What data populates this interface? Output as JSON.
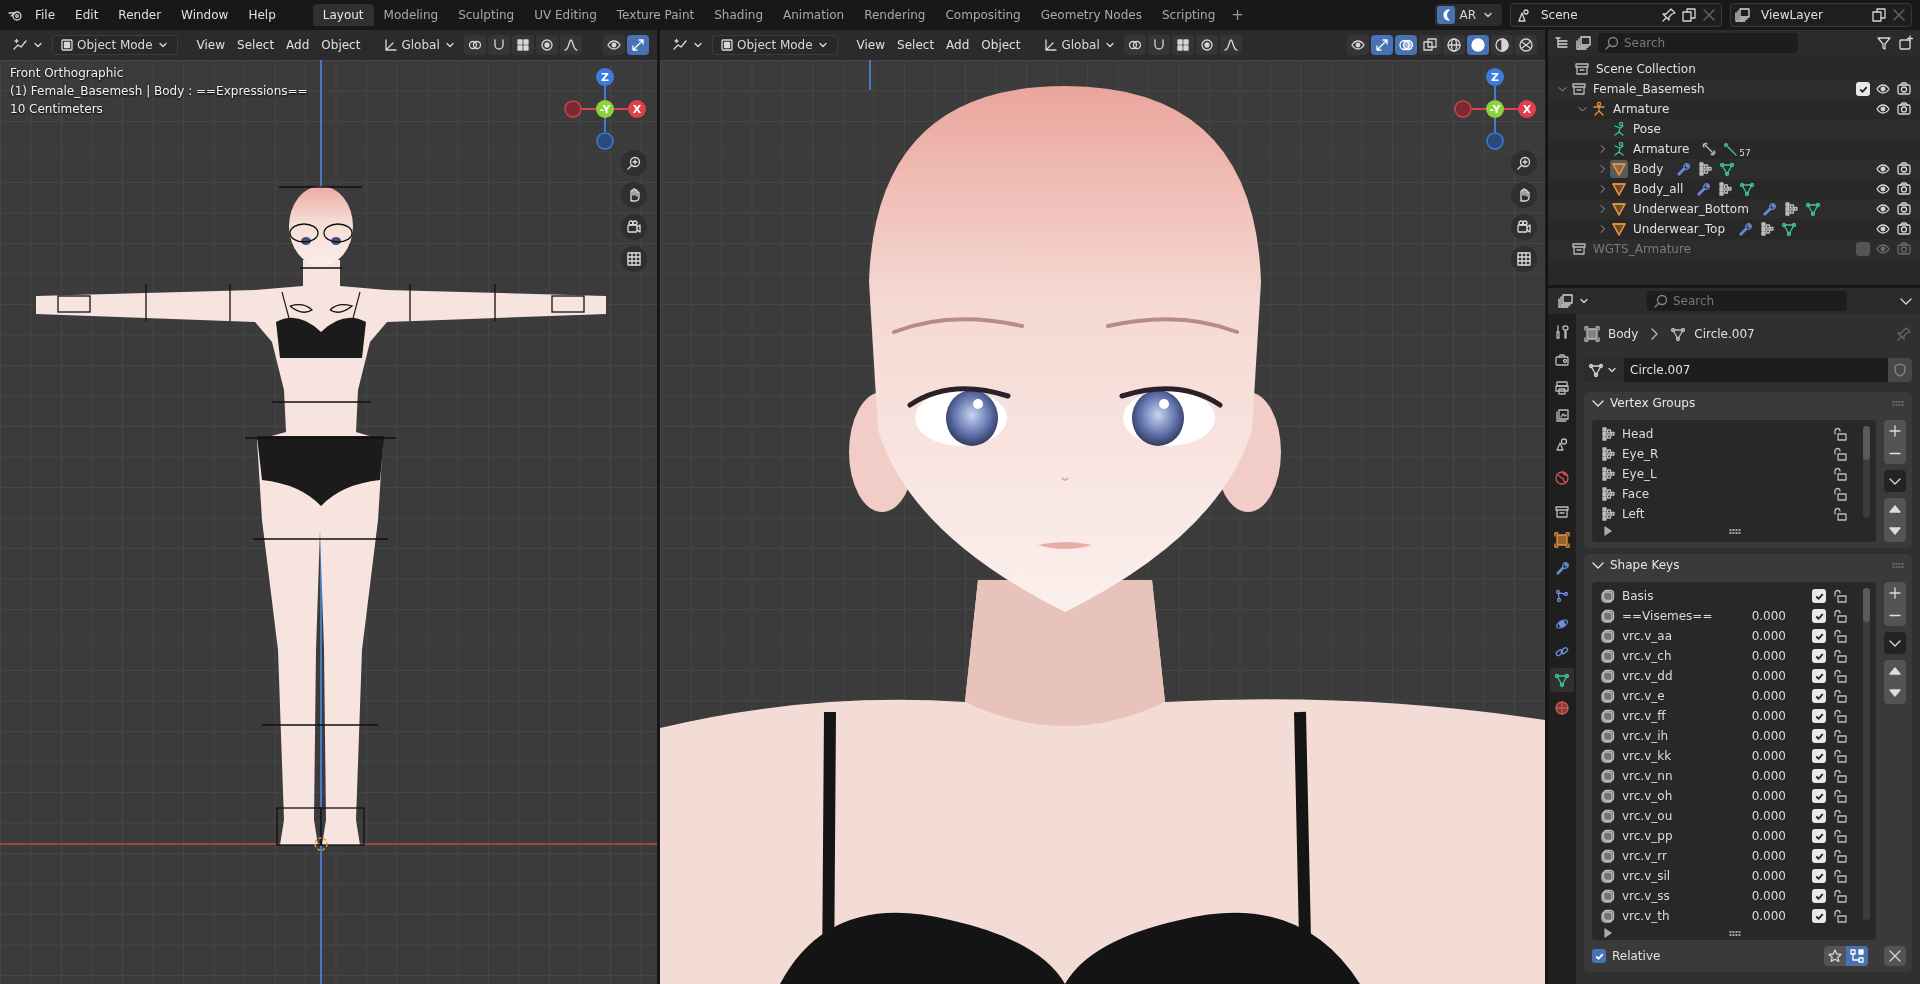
{
  "menu": [
    "File",
    "Edit",
    "Render",
    "Window",
    "Help"
  ],
  "workspaces": [
    {
      "label": "Layout",
      "selected": true
    },
    {
      "label": "Modeling",
      "selected": false
    },
    {
      "label": "Sculpting",
      "selected": false
    },
    {
      "label": "UV Editing",
      "selected": false
    },
    {
      "label": "Texture Paint",
      "selected": false
    },
    {
      "label": "Shading",
      "selected": false
    },
    {
      "label": "Animation",
      "selected": false
    },
    {
      "label": "Rendering",
      "selected": false
    },
    {
      "label": "Compositing",
      "selected": false
    },
    {
      "label": "Geometry Nodes",
      "selected": false
    },
    {
      "label": "Scripting",
      "selected": false
    }
  ],
  "add_workspace": "+",
  "engine": "AR",
  "scene": "Scene",
  "view_layer": "ViewLayer",
  "viewports": [
    {
      "kind": "front",
      "mode": "Object Mode",
      "menus": [
        "View",
        "Select",
        "Add",
        "Object"
      ],
      "orientation": "Global",
      "tools": [
        {
          "kind": "pivot",
          "active": false
        },
        {
          "kind": "snap",
          "active": false
        },
        {
          "kind": "snap_target",
          "active": false
        },
        {
          "kind": "proportional",
          "active": false
        },
        {
          "kind": "falloff",
          "active": false
        }
      ],
      "display_tools": [
        {
          "kind": "visibility",
          "active": false
        },
        {
          "kind": "gizmo",
          "active": true
        }
      ],
      "overlay_text": [
        "Front Orthographic",
        "(1) Female_Basemesh | Body : ==Expressions==",
        "10 Centimeters"
      ],
      "gizmo": {
        "z": "Z",
        "y": "-Y",
        "x": "X"
      }
    },
    {
      "kind": "closeup",
      "mode": "Object Mode",
      "menus": [
        "View",
        "Select",
        "Add",
        "Object"
      ],
      "orientation": "Global",
      "tools": [
        {
          "kind": "pivot",
          "active": false
        },
        {
          "kind": "snap",
          "active": false
        },
        {
          "kind": "snap_target",
          "active": false
        },
        {
          "kind": "proportional",
          "active": false
        },
        {
          "kind": "falloff",
          "active": false
        }
      ],
      "display_tools": [
        {
          "kind": "visibility",
          "active": false
        },
        {
          "kind": "gizmo",
          "active": true
        },
        {
          "kind": "overlay",
          "active": true
        },
        {
          "kind": "xray",
          "active": false
        },
        {
          "kind": "wire",
          "active": false
        },
        {
          "kind": "solid",
          "active": true
        },
        {
          "kind": "material",
          "active": false
        },
        {
          "kind": "rendered",
          "active": false
        }
      ],
      "gizmo": {
        "z": "Z",
        "y": "-Y",
        "x": "X"
      }
    }
  ],
  "outliner": {
    "search": {
      "placeholder": "Search"
    },
    "tree": [
      {
        "name": "Scene Collection",
        "kind": "scene_collection",
        "selected": false,
        "children": [
          {
            "name": "Female_Basemesh",
            "kind": "collection",
            "expanded": true,
            "selected": false,
            "checked": true,
            "disabled": false,
            "toggles": true,
            "children": [
              {
                "name": "Armature",
                "kind": "armature",
                "expanded": true,
                "selected": false,
                "toggles": true,
                "children": [
                  {
                    "name": "Pose",
                    "kind": "pose",
                    "selected": false,
                    "toggles": false
                  },
                  {
                    "name": "Armature",
                    "kind": "armature_data",
                    "expanded": false,
                    "selected": false,
                    "toggles": false,
                    "badge": "57"
                  },
                  {
                    "name": "Body",
                    "kind": "mesh",
                    "expanded": false,
                    "selected": true,
                    "toggles": true
                  },
                  {
                    "name": "Body_all",
                    "kind": "mesh",
                    "expanded": false,
                    "selected": false,
                    "toggles": true
                  },
                  {
                    "name": "Underwear_Bottom",
                    "kind": "mesh",
                    "expanded": false,
                    "selected": false,
                    "toggles": true
                  },
                  {
                    "name": "Underwear_Top",
                    "kind": "mesh",
                    "expanded": false,
                    "selected": false,
                    "toggles": true
                  }
                ]
              }
            ]
          },
          {
            "name": "WGTS_Armature",
            "kind": "collection",
            "selected": false,
            "checked": false,
            "disabled": true,
            "toggles": true
          }
        ]
      }
    ]
  },
  "properties": {
    "search": {
      "placeholder": "Search"
    },
    "tabs": [
      {
        "kind": "tool",
        "selected": false
      },
      {
        "kind": "render",
        "selected": false
      },
      {
        "kind": "output",
        "selected": false
      },
      {
        "kind": "view_layer",
        "selected": false
      },
      {
        "kind": "scene",
        "selected": false
      },
      {
        "kind": "world",
        "selected": false
      },
      {
        "kind": "collection",
        "selected": false
      },
      {
        "kind": "object",
        "selected": false
      },
      {
        "kind": "modifiers",
        "selected": false
      },
      {
        "kind": "particles",
        "selected": false
      },
      {
        "kind": "physics",
        "selected": false
      },
      {
        "kind": "constraints",
        "selected": false
      },
      {
        "kind": "data",
        "selected": true
      },
      {
        "kind": "material",
        "selected": false
      }
    ],
    "breadcrumb": [
      "Body",
      "Circle.007"
    ],
    "mesh_name": "Circle.007",
    "vertex_groups": {
      "title": "Vertex Groups",
      "expanded": true,
      "items": [
        "Head",
        "Eye_R",
        "Eye_L",
        "Face",
        "Left"
      ]
    },
    "shape_keys": {
      "title": "Shape Keys",
      "expanded": true,
      "items": [
        {
          "name": "Basis",
          "checked": true
        },
        {
          "name": "==Visemes==",
          "value": "0.000",
          "checked": true
        },
        {
          "name": "vrc.v_aa",
          "value": "0.000",
          "checked": true
        },
        {
          "name": "vrc.v_ch",
          "value": "0.000",
          "checked": true
        },
        {
          "name": "vrc.v_dd",
          "value": "0.000",
          "checked": true
        },
        {
          "name": "vrc.v_e",
          "value": "0.000",
          "checked": true
        },
        {
          "name": "vrc.v_ff",
          "value": "0.000",
          "checked": true
        },
        {
          "name": "vrc.v_ih",
          "value": "0.000",
          "checked": true
        },
        {
          "name": "vrc.v_kk",
          "value": "0.000",
          "checked": true
        },
        {
          "name": "vrc.v_nn",
          "value": "0.000",
          "checked": true
        },
        {
          "name": "vrc.v_oh",
          "value": "0.000",
          "checked": true
        },
        {
          "name": "vrc.v_ou",
          "value": "0.000",
          "checked": true
        },
        {
          "name": "vrc.v_pp",
          "value": "0.000",
          "checked": true
        },
        {
          "name": "vrc.v_rr",
          "value": "0.000",
          "checked": true
        },
        {
          "name": "vrc.v_sil",
          "value": "0.000",
          "checked": true
        },
        {
          "name": "vrc.v_ss",
          "value": "0.000",
          "checked": true
        },
        {
          "name": "vrc.v_th",
          "value": "0.000",
          "checked": true
        }
      ],
      "relative": {
        "label": "Relative",
        "checked": true
      }
    }
  }
}
